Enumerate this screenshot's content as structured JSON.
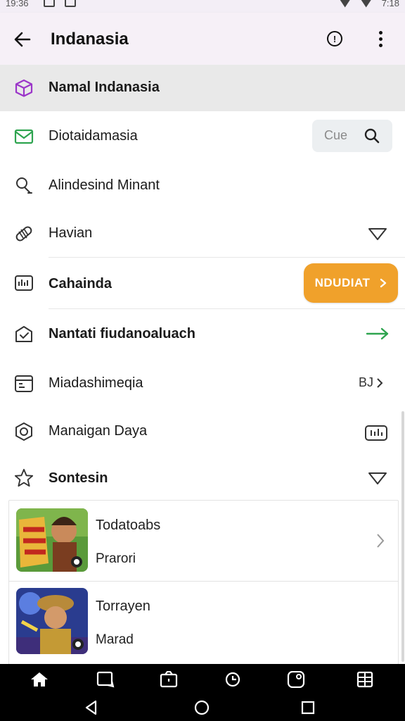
{
  "status_bar": {
    "time": "19:36",
    "battery": "7:18"
  },
  "app_bar": {
    "title": "Indanasia",
    "back_icon": "arrow-left-icon",
    "info_icon": "info-circle-icon",
    "more_icon": "more-vertical-icon"
  },
  "menu": {
    "selected": {
      "label": "Namal Indanasia",
      "icon": "cube-icon",
      "color": "#9b35c9"
    },
    "items": [
      {
        "label": "Diotaidamasia",
        "icon": "mail-icon",
        "color": "#2ea44f"
      },
      {
        "label": "Alindesind Minant",
        "icon": "person-icon"
      },
      {
        "label": "Havian",
        "icon": "pill-icon"
      },
      {
        "label": "Cahainda",
        "icon": "chart-card-icon"
      },
      {
        "label": "Nantati fiudanoaluach",
        "icon": "envelope-check-icon"
      },
      {
        "label": "Miadashimeqia",
        "icon": "calendar-icon"
      },
      {
        "label": "Manaigan Daya",
        "icon": "shield-circle-icon"
      },
      {
        "label": "Sontesin",
        "icon": "star-icon"
      }
    ]
  },
  "search_chip": {
    "text": "Cue",
    "icon": "search-icon"
  },
  "cta_button": {
    "label": "NDUDIAT",
    "color": "#f0a12b"
  },
  "trailing": {
    "miadash_text": "BJ"
  },
  "cards": [
    {
      "title": "Todatoabs",
      "subtitle": "Prarori"
    },
    {
      "title": "Torrayen",
      "subtitle": "Marad"
    }
  ],
  "bottom_nav": {
    "tabs": [
      "home-icon",
      "tablet-icon",
      "wallet-icon",
      "clock-icon",
      "instagram-icon",
      "grid-icon"
    ]
  },
  "accent": {
    "green_arrow": "#2ea44f"
  }
}
